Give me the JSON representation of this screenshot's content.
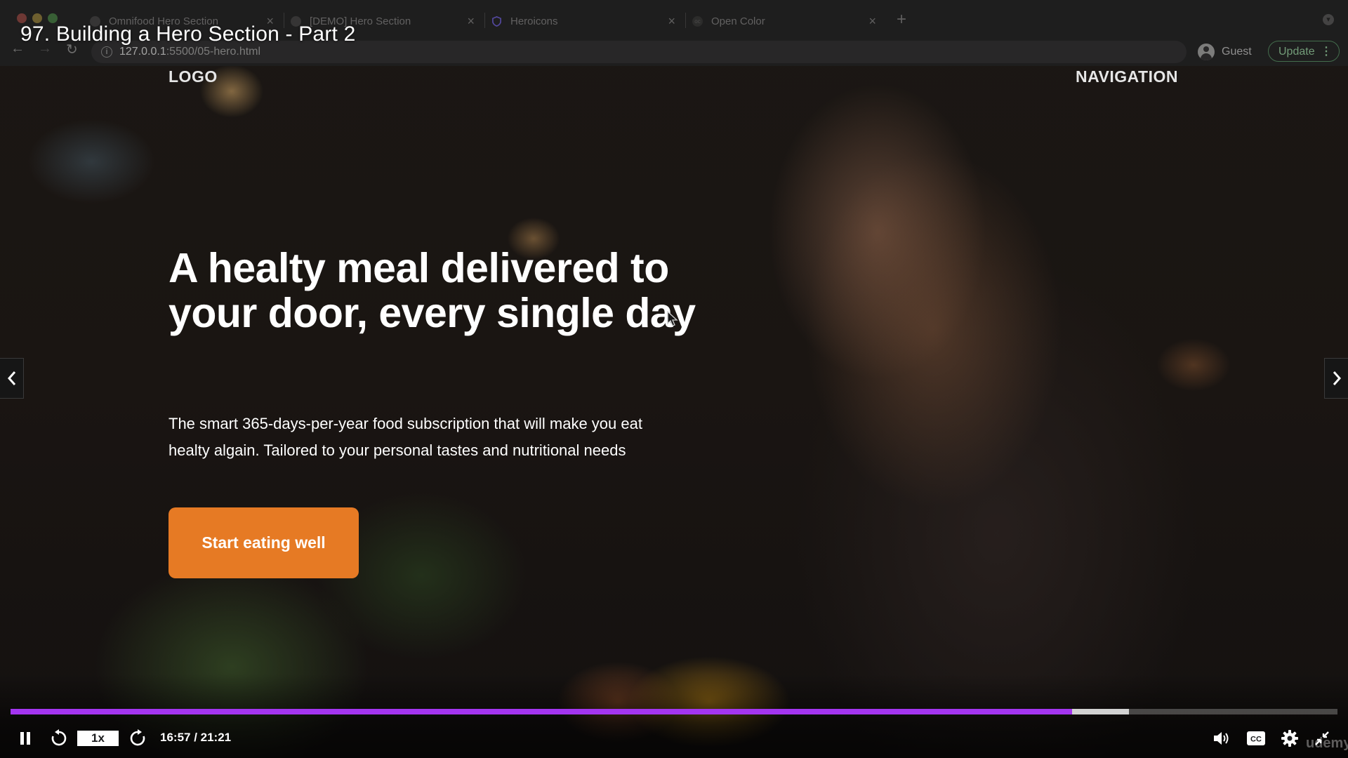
{
  "browser": {
    "tabs": [
      {
        "label": "Omnifood Hero Section",
        "active": true
      },
      {
        "label": "[DEMO] Hero Section",
        "active": false
      },
      {
        "label": "Heroicons",
        "active": false
      },
      {
        "label": "Open Color",
        "active": false
      }
    ],
    "url_host": "127.0.0.1",
    "url_path": ":5500/05-hero.html",
    "profile_label": "Guest",
    "update_label": "Update"
  },
  "video": {
    "title": "97. Building a Hero Section - Part 2",
    "speed": "1x",
    "time": "16:57 / 21:21",
    "progress_played": 0.8,
    "progress_buffered": 0.843,
    "watermark": "udemy"
  },
  "hero": {
    "logo": "LOGO",
    "navigation": "NAVIGATION",
    "heading": "A healty meal delivered to your door, every single day",
    "description": "The smart 365-days-per-year food subscription that will make you eat healty algain. Tailored to your personal tastes and nutritional needs",
    "cta_label": "Start eating well"
  },
  "colors": {
    "cta": "#e67a24",
    "progress": "#a435f0",
    "update_button": "#7fae86"
  },
  "icons": {
    "play_pause": "pause-icon",
    "rewind": "rewind-5s-icon",
    "forward": "forward-5s-icon",
    "volume": "volume-icon",
    "captions": "closed-captions-icon",
    "settings": "gear-icon",
    "fullscreen": "exit-fullscreen-icon",
    "prev": "chevron-left-icon",
    "next": "chevron-right-icon"
  }
}
